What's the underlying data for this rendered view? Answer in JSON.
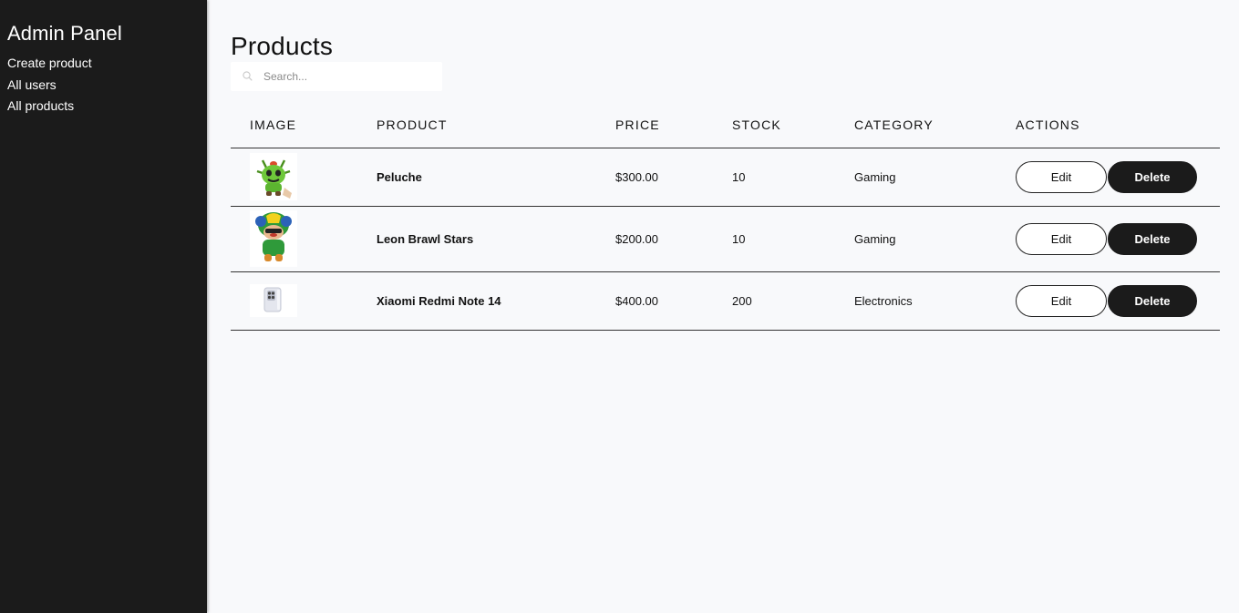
{
  "sidebar": {
    "title": "Admin Panel",
    "links": [
      {
        "label": "Create product"
      },
      {
        "label": "All users"
      },
      {
        "label": "All products"
      }
    ]
  },
  "main": {
    "title": "Products",
    "search": {
      "placeholder": "Search...",
      "value": ""
    },
    "table": {
      "headers": [
        "IMAGE",
        "PRODUCT",
        "PRICE",
        "STOCK",
        "CATEGORY",
        "ACTIONS"
      ],
      "rows": [
        {
          "image": "spike-plush-thumbnail",
          "name": "Peluche",
          "price": "$300.00",
          "stock": "10",
          "category": "Gaming"
        },
        {
          "image": "leon-plush-thumbnail",
          "name": "Leon Brawl Stars",
          "price": "$200.00",
          "stock": "10",
          "category": "Gaming"
        },
        {
          "image": "phone-thumbnail",
          "name": "Xiaomi Redmi Note 14",
          "price": "$400.00",
          "stock": "200",
          "category": "Electronics"
        }
      ],
      "edit_label": "Edit",
      "delete_label": "Delete"
    }
  },
  "colors": {
    "sidebar_bg": "#1b1b1b",
    "page_bg": "#f8f9fb",
    "delete_button_bg": "#1b1b1b"
  }
}
